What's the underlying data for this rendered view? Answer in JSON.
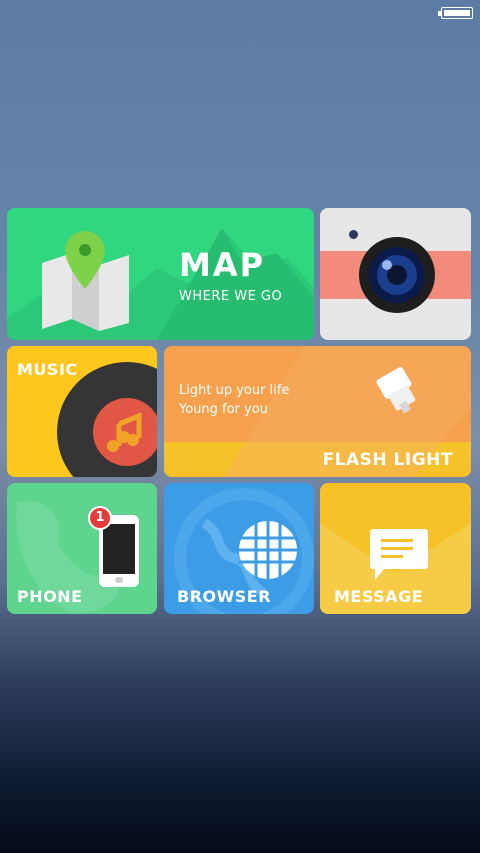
{
  "status_bar": {
    "battery_level": 1.0
  },
  "tiles": {
    "map": {
      "title": "MAP",
      "subtitle": "WHERE WE GO",
      "color": "#31d680"
    },
    "camera": {
      "color": "#e7e7e7",
      "accent": "#f28b7c"
    },
    "music": {
      "title": "MUSIC",
      "color": "#fdc71d"
    },
    "flashlight": {
      "line1": "Light up your life",
      "line2": "Young for you",
      "title": "FLASH LIGHT",
      "color": "#f5a04c"
    },
    "phone": {
      "title": "PHONE",
      "badge": "1",
      "color": "#5ed48f"
    },
    "browser": {
      "title": "BROWSER",
      "color": "#3d9ce6"
    },
    "message": {
      "title": "MESSAGE",
      "color": "#f6c228"
    }
  }
}
